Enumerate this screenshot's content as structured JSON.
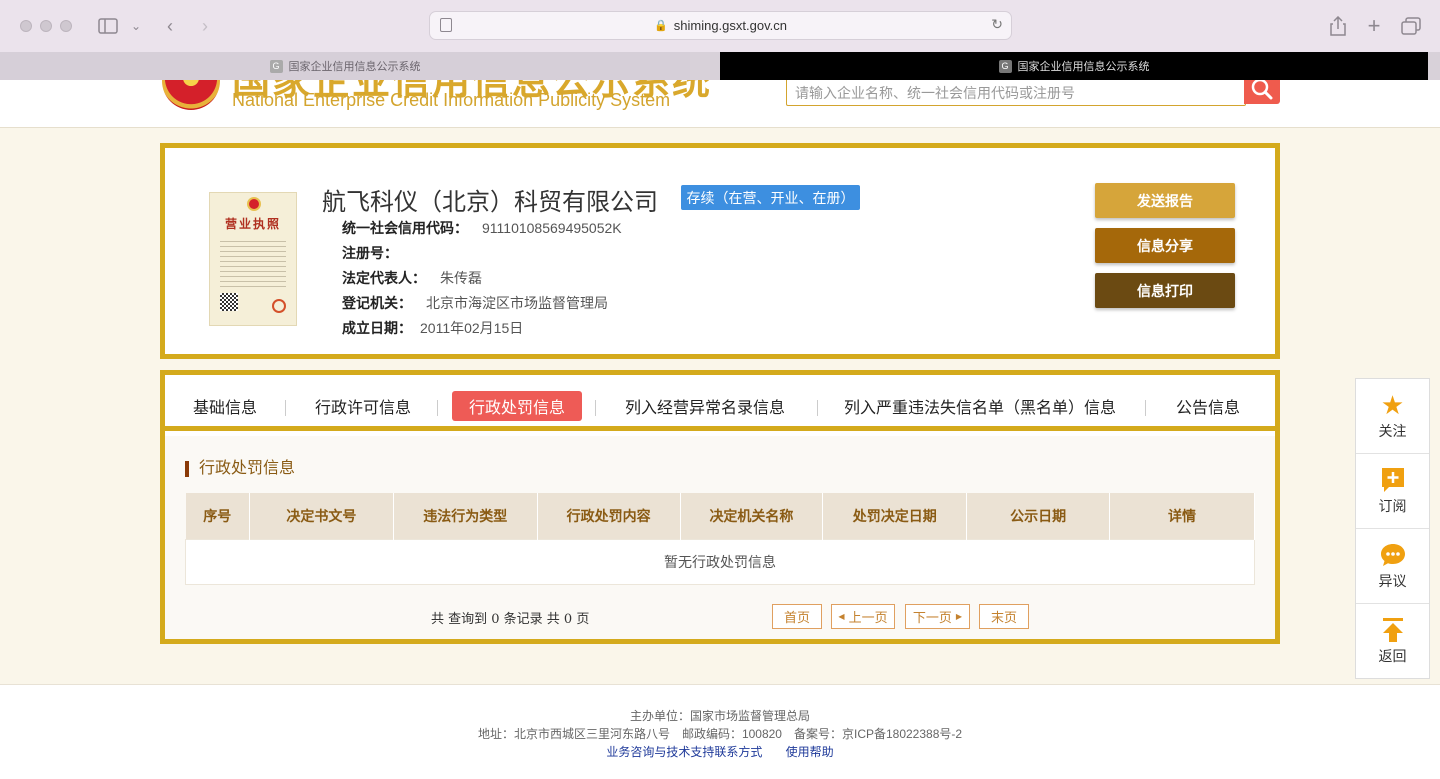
{
  "browser": {
    "url": "shiming.gsxt.gov.cn",
    "tabs": [
      {
        "title": "国家企业信用信息公示系统",
        "active": false
      },
      {
        "title": "国家企业信用信息公示系统",
        "active": true
      }
    ]
  },
  "site": {
    "cn_title": "国家企业信用信息公示系统",
    "en_title": "National Enterprise Credit Information Publicity System",
    "search_placeholder": "请输入企业名称、统一社会信用代码或注册号",
    "license_title": "营业执照"
  },
  "company": {
    "name": "航飞科仪（北京）科贸有限公司",
    "status": "存续（在营、开业、在册）",
    "fields": [
      {
        "label": "统一社会信用代码：",
        "value": "91110108569495052K"
      },
      {
        "label": "注册号：",
        "value": ""
      },
      {
        "label": "法定代表人：",
        "value": "朱传磊"
      },
      {
        "label": "登记机关：",
        "value": "北京市海淀区市场监督管理局"
      },
      {
        "label": "成立日期：",
        "value": "2011年02月15日"
      }
    ],
    "actions": [
      {
        "label": "发送报告",
        "color": "#d6a53a"
      },
      {
        "label": "信息分享",
        "color": "#a5680a"
      },
      {
        "label": "信息打印",
        "color": "#6b4a12"
      }
    ]
  },
  "info_tabs": [
    {
      "label": "基础信息",
      "active": false
    },
    {
      "label": "行政许可信息",
      "active": false
    },
    {
      "label": "行政处罚信息",
      "active": true
    },
    {
      "label": "列入经营异常名录信息",
      "active": false
    },
    {
      "label": "列入严重违法失信名单（黑名单）信息",
      "active": false
    },
    {
      "label": "公告信息",
      "active": false
    }
  ],
  "section": {
    "title": "行政处罚信息",
    "columns": [
      "序号",
      "决定书文号",
      "违法行为类型",
      "行政处罚内容",
      "决定机关名称",
      "处罚决定日期",
      "公示日期",
      "详情"
    ],
    "empty_text": "暂无行政处罚信息",
    "pager": {
      "summary": "共 查询到 0 条记录 共 0 页",
      "first": "首页",
      "prev": "上一页",
      "next": "下一页",
      "last": "末页"
    }
  },
  "floatbar": [
    {
      "label": "关注",
      "icon": "star-icon"
    },
    {
      "label": "订阅",
      "icon": "plus-square-icon"
    },
    {
      "label": "异议",
      "icon": "chat-icon"
    },
    {
      "label": "返回",
      "icon": "arrow-up-icon"
    }
  ],
  "footer": {
    "host": "主办单位：国家市场监督管理总局",
    "address": "地址：北京市西城区三里河东路八号　邮政编码：100820　备案号：京ICP备18022388号-2",
    "link_support": "业务咨询与技术支持联系方式",
    "link_help": "使用帮助"
  }
}
